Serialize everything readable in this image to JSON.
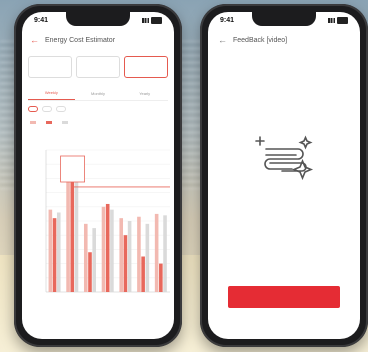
{
  "left_phone": {
    "status_time": "9:41",
    "header": {
      "back_icon": "arrow-left-icon",
      "title": "Energy Cost Estimator"
    },
    "summary_cards": [
      {
        "label": "",
        "value": ""
      },
      {
        "label": "",
        "value": ""
      },
      {
        "label": "",
        "value": ""
      }
    ],
    "tabs": [
      "Weekly",
      "Monthly",
      "Yearly"
    ],
    "active_tab": 0,
    "chips": [
      "",
      "",
      ""
    ],
    "legend": [
      "",
      "",
      ""
    ],
    "footer": [
      "",
      "",
      ""
    ],
    "chart_data": {
      "type": "bar",
      "categories": [
        "",
        "",
        "",
        "",
        "",
        "",
        ""
      ],
      "series": [
        {
          "values": [
            58,
            95,
            48,
            60,
            52,
            53,
            55
          ]
        },
        {
          "values": [
            52,
            84,
            28,
            62,
            40,
            25,
            20
          ]
        },
        {
          "values": [
            56,
            80,
            45,
            58,
            50,
            48,
            54
          ]
        }
      ],
      "ylim": [
        0,
        100
      ],
      "highlight_index": 1,
      "tooltip": [
        "",
        "",
        ""
      ],
      "colors": [
        "#f2b9b1",
        "#e8685c",
        "#dadada"
      ]
    }
  },
  "right_phone": {
    "status_time": "9:41",
    "header": {
      "back_icon": "arrow-left-icon",
      "title": "FeedBack [video]"
    },
    "description": "",
    "illustration_icon": "sparkle-lines-icon",
    "caption": "",
    "button_label": "",
    "accent": "#e52c34"
  }
}
